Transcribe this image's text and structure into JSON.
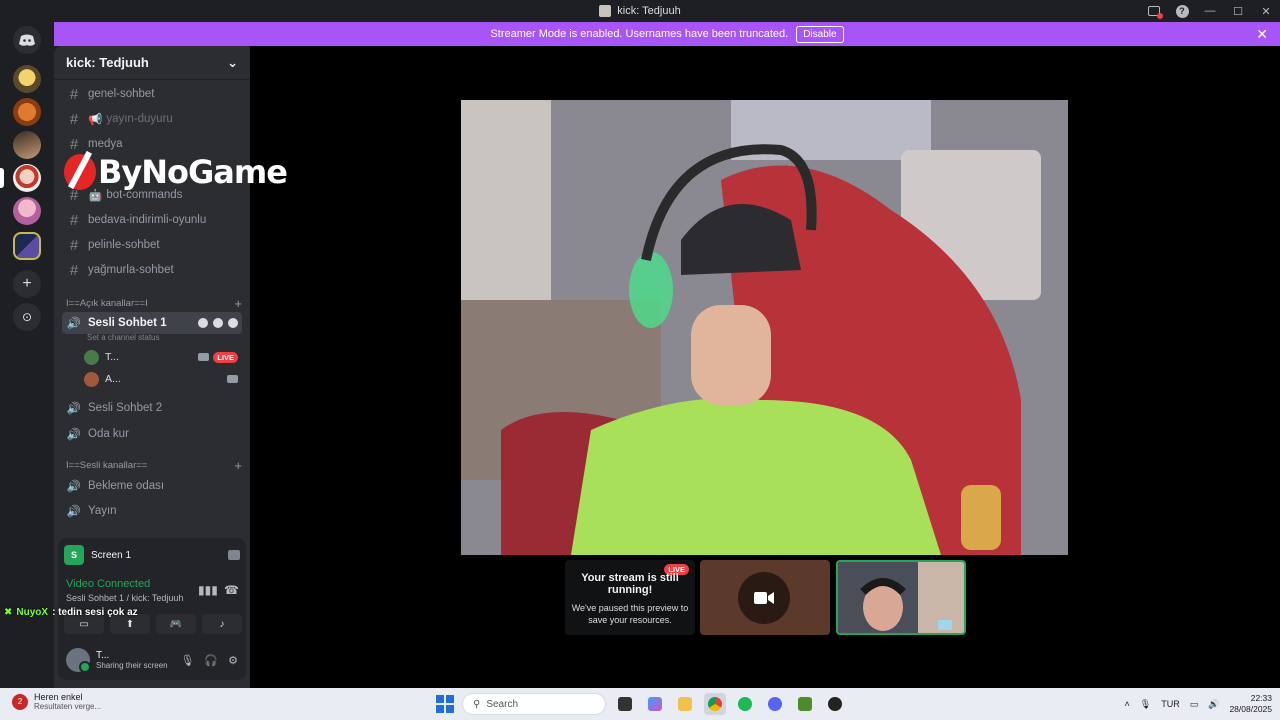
{
  "window": {
    "title": "kick: Tedjuuh"
  },
  "banner": {
    "message": "Streamer Mode is enabled. Usernames have been truncated.",
    "disable_label": "Disable",
    "close_glyph": "✕"
  },
  "server": {
    "name": "kick: Tedjuuh",
    "chevron": "⌄"
  },
  "text_channels": [
    {
      "name": "genel-sohbet"
    },
    {
      "name": "yayın-duyuru"
    },
    {
      "name": "medya"
    },
    {
      "name": "bot-commands"
    },
    {
      "name": "bedava-indirimli-oyunlu"
    },
    {
      "name": "pelinle-sohbet"
    },
    {
      "name": "yağmurla-sohbet"
    }
  ],
  "categories": {
    "open": "I==Açık kanallar==I",
    "voice": "I==Sesli kanallar=="
  },
  "voice_channels": {
    "active": "Sesli Sohbet 1",
    "status_placeholder": "Set a channel status",
    "users": [
      {
        "name": "T...",
        "live": "LIVE"
      },
      {
        "name": "A..."
      }
    ],
    "others": [
      "Sesli Sohbet 2",
      "Oda kur"
    ],
    "voice_list": [
      "Bekleme odası",
      "Yayın"
    ]
  },
  "voice_panel": {
    "screen_label": "Screen 1",
    "screen_badge": "S",
    "connected": "Video Connected",
    "location": "Sesli Sohbet 1 / kick: Tedjuuh"
  },
  "user": {
    "name": "T...",
    "status": "Sharing their screen"
  },
  "stage": {
    "paused_title": "Your stream is still running!",
    "paused_body": "We've paused this preview to save your resources.",
    "live": "LIVE"
  },
  "overlay": {
    "logo_text": "ByNoGame",
    "chat_user": "NuyoX",
    "chat_message": ": tedin sesi çok az"
  },
  "taskbar": {
    "news_title": "Heren enkel",
    "news_sub": "Resultaten verge...",
    "news_badge": "2",
    "search_placeholder": "Search",
    "lang": "TUR",
    "time": "22:33",
    "date": "28/08/2025"
  },
  "colors": {
    "accent": "#a855f7",
    "online": "#23a55a",
    "live": "#f23f43"
  }
}
